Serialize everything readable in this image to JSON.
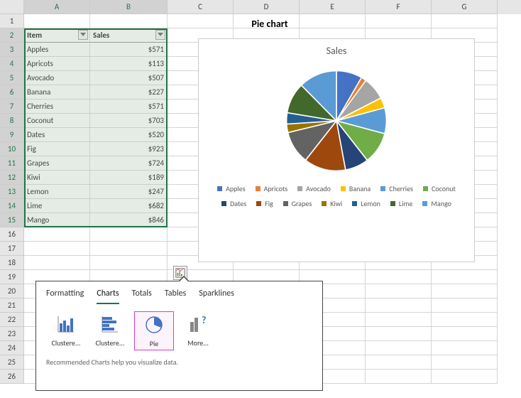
{
  "columns": [
    "A",
    "B",
    "C",
    "D",
    "E",
    "F",
    "G"
  ],
  "rows_count": 26,
  "title_cell": "Pie chart",
  "table": {
    "headers": {
      "item": "Item",
      "sales": "Sales"
    },
    "rows": [
      {
        "item": "Apples",
        "sales": "$571"
      },
      {
        "item": "Apricots",
        "sales": "$113"
      },
      {
        "item": "Avocado",
        "sales": "$507"
      },
      {
        "item": "Banana",
        "sales": "$227"
      },
      {
        "item": "Cherries",
        "sales": "$571"
      },
      {
        "item": "Coconut",
        "sales": "$703"
      },
      {
        "item": "Dates",
        "sales": "$520"
      },
      {
        "item": "Fig",
        "sales": "$923"
      },
      {
        "item": "Grapes",
        "sales": "$724"
      },
      {
        "item": "Kiwi",
        "sales": "$189"
      },
      {
        "item": "Lemon",
        "sales": "$247"
      },
      {
        "item": "Lime",
        "sales": "$682"
      },
      {
        "item": "Mango",
        "sales": "$846"
      }
    ]
  },
  "chart_data": {
    "type": "pie",
    "title": "Sales",
    "categories": [
      "Apples",
      "Apricots",
      "Avocado",
      "Banana",
      "Cherries",
      "Coconut",
      "Dates",
      "Fig",
      "Grapes",
      "Kiwi",
      "Lemon",
      "Lime",
      "Mango"
    ],
    "values": [
      571,
      113,
      507,
      227,
      571,
      703,
      520,
      923,
      724,
      189,
      247,
      682,
      846
    ],
    "colors": [
      "#4472c4",
      "#ed7d31",
      "#a5a5a5",
      "#ffc000",
      "#5b9bd5",
      "#70ad47",
      "#264478",
      "#9e480e",
      "#636363",
      "#997300",
      "#255e91",
      "#43682b",
      "#5b9bd5"
    ]
  },
  "quick_analysis": {
    "tabs": [
      "Formatting",
      "Charts",
      "Totals",
      "Tables",
      "Sparklines"
    ],
    "active_tab": "Charts",
    "items": [
      {
        "label": "Clustere...",
        "icon": "clustered-column"
      },
      {
        "label": "Clustere...",
        "icon": "clustered-bar"
      },
      {
        "label": "Pie",
        "icon": "pie",
        "selected": true
      },
      {
        "label": "More...",
        "icon": "more"
      }
    ],
    "description": "Recommended Charts help you visualize data."
  }
}
